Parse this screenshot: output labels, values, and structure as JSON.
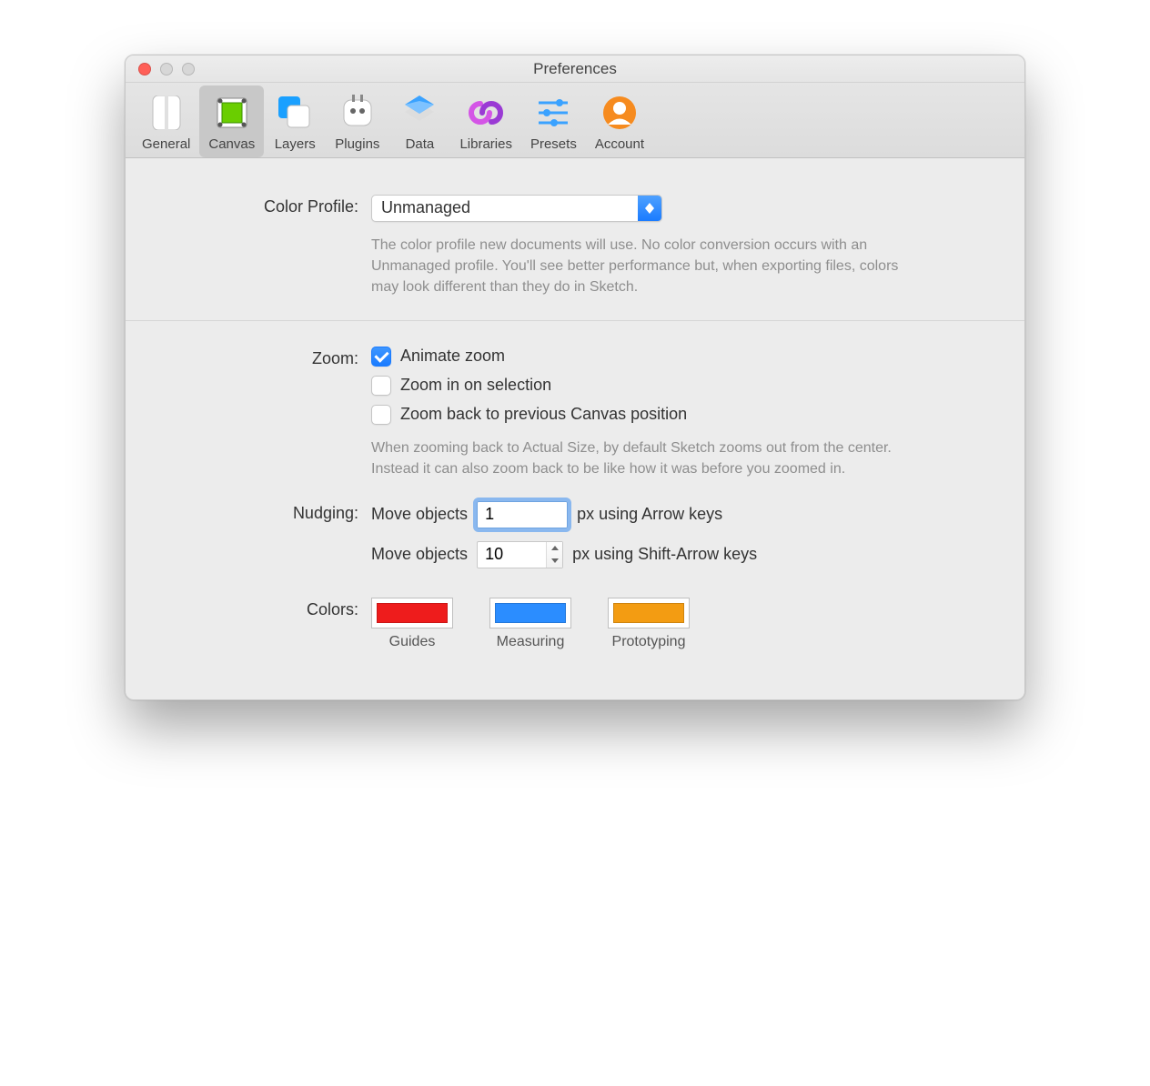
{
  "window": {
    "title": "Preferences"
  },
  "toolbar": {
    "items": [
      {
        "label": "General"
      },
      {
        "label": "Canvas"
      },
      {
        "label": "Layers"
      },
      {
        "label": "Plugins"
      },
      {
        "label": "Data"
      },
      {
        "label": "Libraries"
      },
      {
        "label": "Presets"
      },
      {
        "label": "Account"
      }
    ],
    "selected": "Canvas"
  },
  "colorProfile": {
    "label": "Color Profile:",
    "value": "Unmanaged",
    "help": "The color profile new documents will use. No color conversion occurs with an Unmanaged profile. You'll see better performance but, when exporting files, colors may look different than they do in Sketch."
  },
  "zoom": {
    "label": "Zoom:",
    "animate": {
      "label": "Animate zoom",
      "checked": true
    },
    "onSelection": {
      "label": "Zoom in on selection",
      "checked": false
    },
    "backPrevious": {
      "label": "Zoom back to previous Canvas position",
      "checked": false
    },
    "help": "When zooming back to Actual Size, by default Sketch zooms out from the center. Instead it can also zoom back to be like how it was before you zoomed in."
  },
  "nudging": {
    "label": "Nudging:",
    "prefix": "Move objects",
    "arrow": {
      "value": "1",
      "suffix": "px using Arrow keys"
    },
    "shiftArrow": {
      "value": "10",
      "suffix": "px using Shift-Arrow keys"
    }
  },
  "colors": {
    "label": "Colors:",
    "items": [
      {
        "label": "Guides",
        "hex": "#ee1c1c"
      },
      {
        "label": "Measuring",
        "hex": "#2b8dff"
      },
      {
        "label": "Prototyping",
        "hex": "#f39c12"
      }
    ]
  }
}
